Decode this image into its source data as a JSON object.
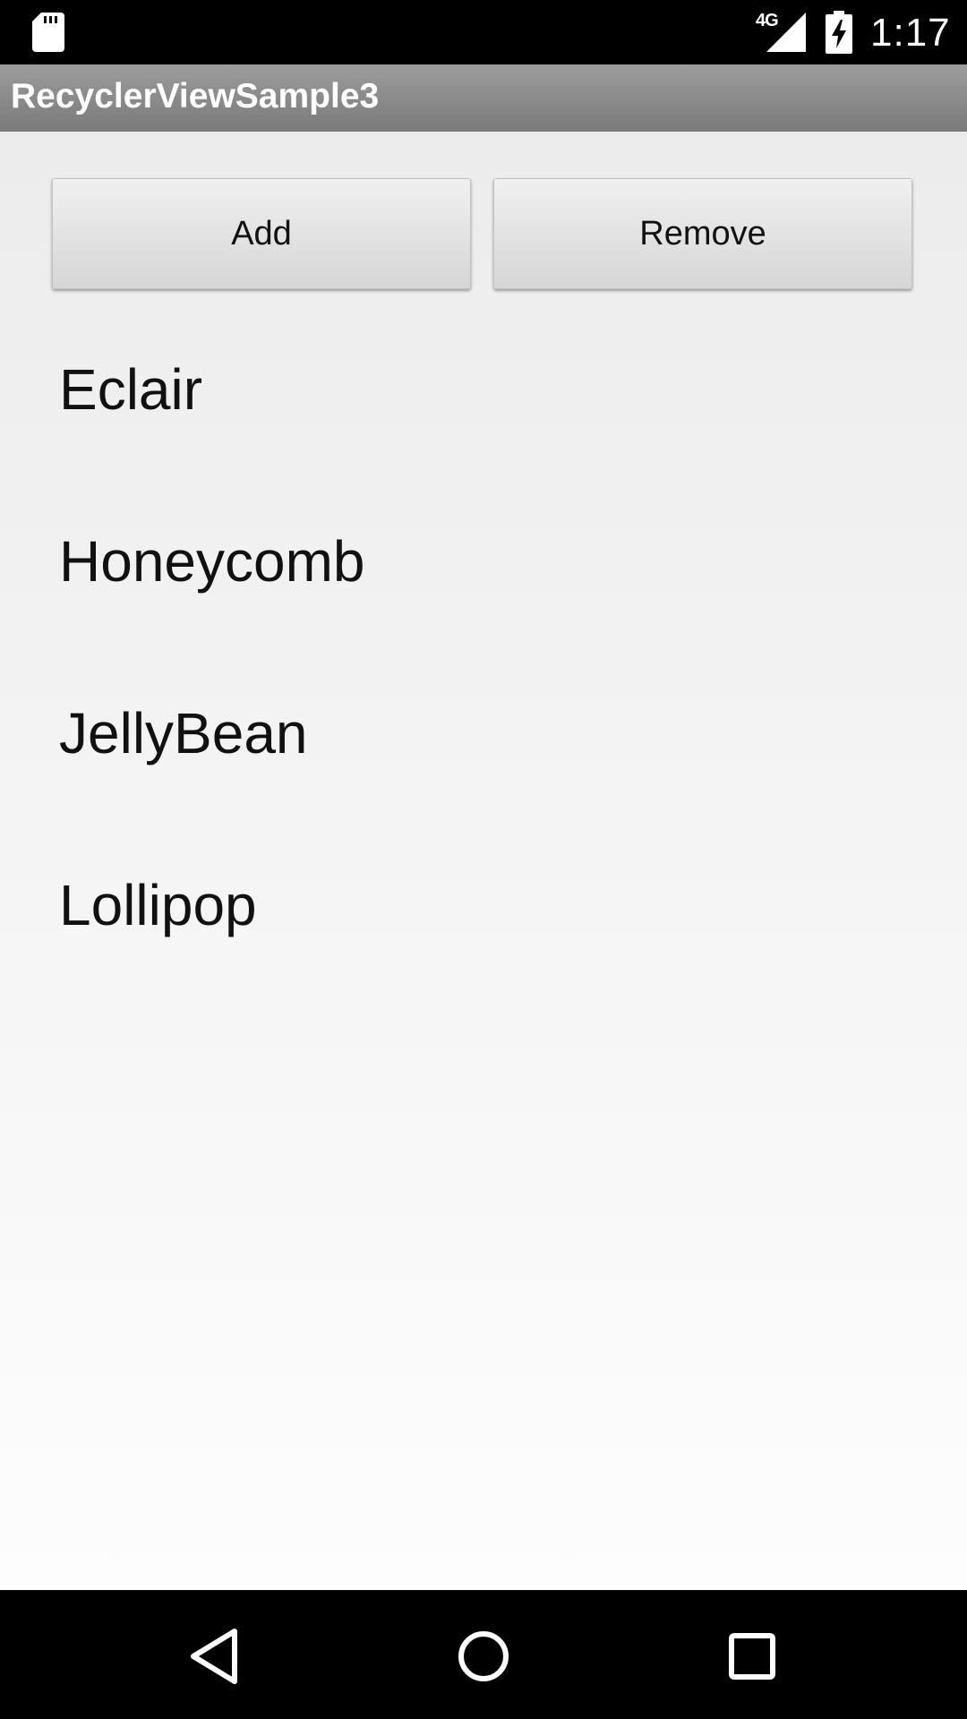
{
  "status_bar": {
    "network_type": "4G",
    "time": "1:17",
    "icons": [
      "sd-card-icon",
      "signal-icon",
      "battery-charging-icon"
    ]
  },
  "action_bar": {
    "title": "RecyclerViewSample3"
  },
  "buttons": {
    "add_label": "Add",
    "remove_label": "Remove"
  },
  "list": {
    "items": [
      "Eclair",
      "Honeycomb",
      "JellyBean",
      "Lollipop"
    ]
  },
  "nav_bar": {
    "icons": [
      "back-icon",
      "home-icon",
      "recent-apps-icon"
    ]
  }
}
